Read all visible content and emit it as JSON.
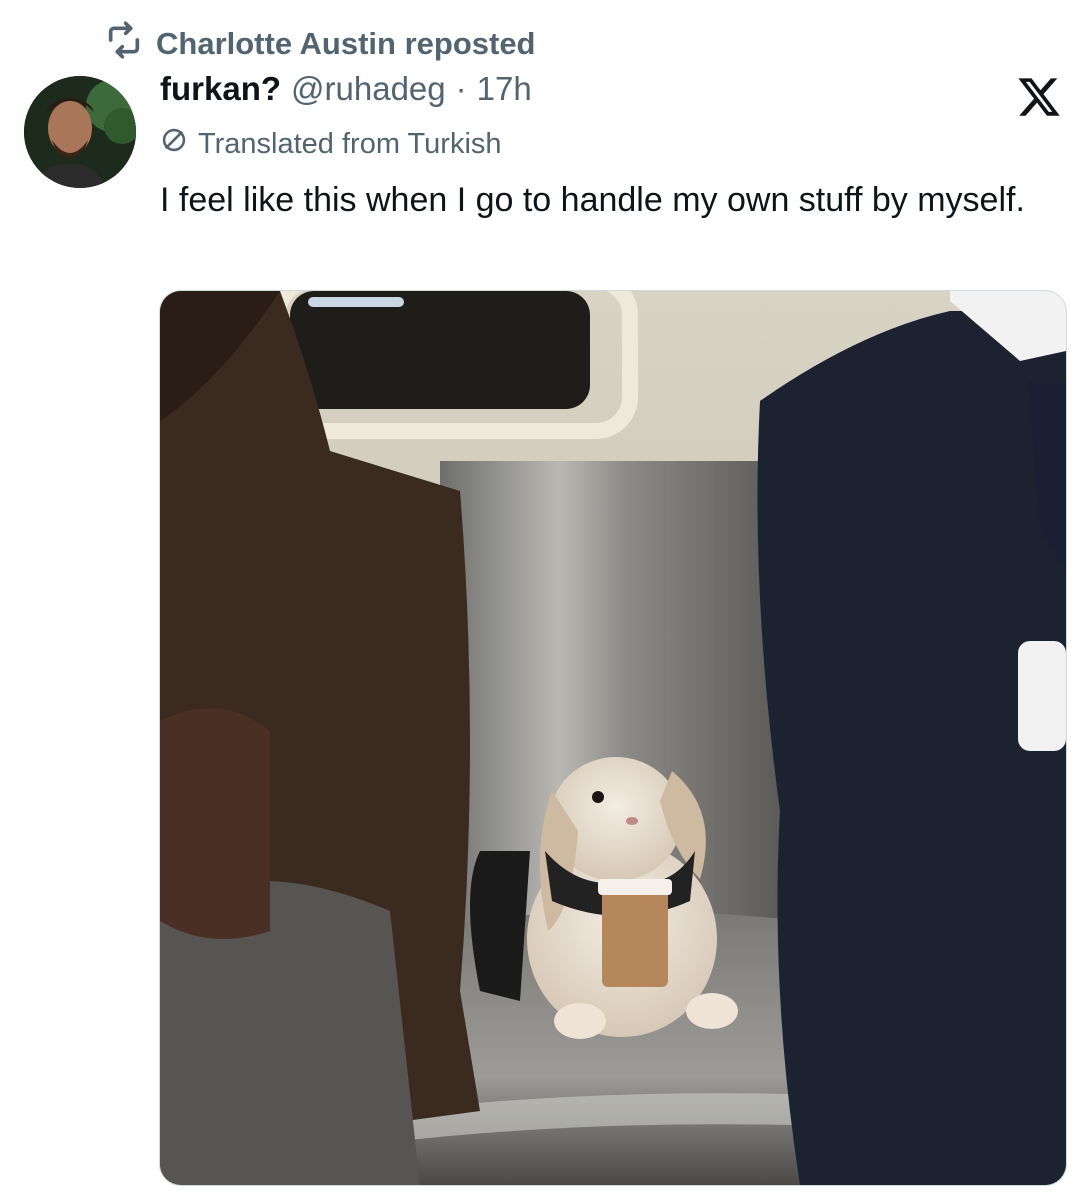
{
  "repost": {
    "icon": "repost-icon",
    "label": "Charlotte Austin reposted"
  },
  "tweet": {
    "author": {
      "display_name": "furkan?",
      "handle": "@ruhadeg",
      "separator": "·",
      "time": "17h",
      "avatar_icon": "avatar"
    },
    "translation_note": "Translated from Turkish",
    "text": "I feel like this when I go to handle my own stuff by myself.",
    "media": {
      "type": "photo",
      "subject": "bunny-on-subway-photo"
    }
  },
  "colors": {
    "text_primary": "#0f1419",
    "text_secondary": "#536471",
    "border": "#cfd9de"
  },
  "icons": [
    "repost-icon",
    "x-logo-icon",
    "translate-icon"
  ]
}
